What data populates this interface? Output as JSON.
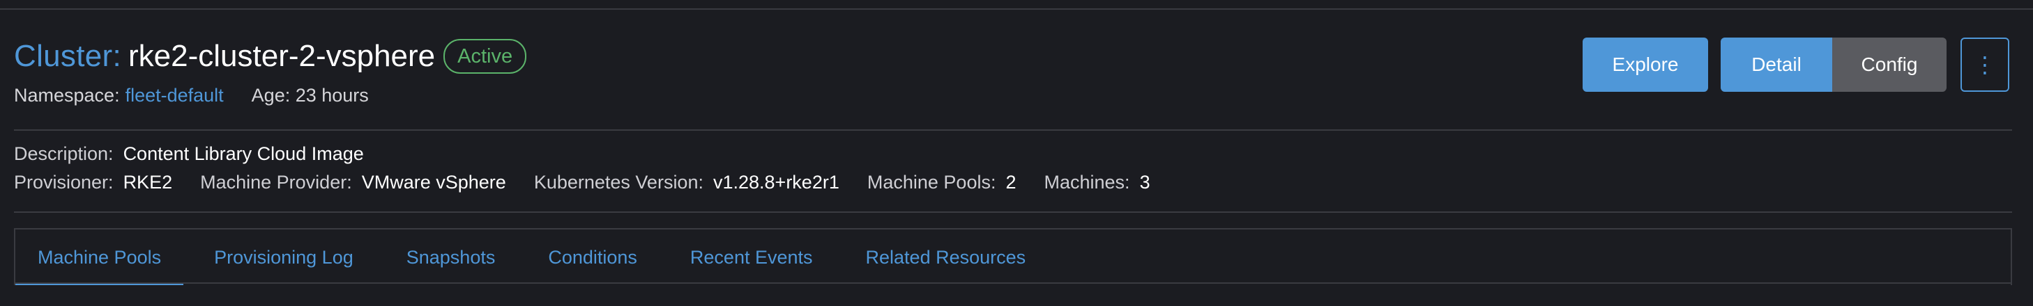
{
  "header": {
    "title_prefix": "Cluster:",
    "cluster_name": "rke2-cluster-2-vsphere",
    "status": "Active"
  },
  "meta": {
    "namespace_label": "Namespace:",
    "namespace_value": "fleet-default",
    "age": "Age: 23 hours"
  },
  "description": {
    "label": "Description:",
    "value": "Content Library Cloud Image"
  },
  "details": {
    "provisioner_label": "Provisioner:",
    "provisioner_value": "RKE2",
    "machine_provider_label": "Machine Provider:",
    "machine_provider_value": "VMware vSphere",
    "k8s_version_label": "Kubernetes Version:",
    "k8s_version_value": "v1.28.8+rke2r1",
    "machine_pools_label": "Machine Pools:",
    "machine_pools_value": "2",
    "machines_label": "Machines:",
    "machines_value": "3"
  },
  "actions": {
    "explore": "Explore",
    "detail": "Detail",
    "config": "Config",
    "more": "⋮"
  },
  "tabs": [
    {
      "label": "Machine Pools"
    },
    {
      "label": "Provisioning Log"
    },
    {
      "label": "Snapshots"
    },
    {
      "label": "Conditions"
    },
    {
      "label": "Recent Events"
    },
    {
      "label": "Related Resources"
    }
  ],
  "colors": {
    "accent": "#4f97d8",
    "status_active": "#5bb36a",
    "background": "#1b1c21"
  }
}
